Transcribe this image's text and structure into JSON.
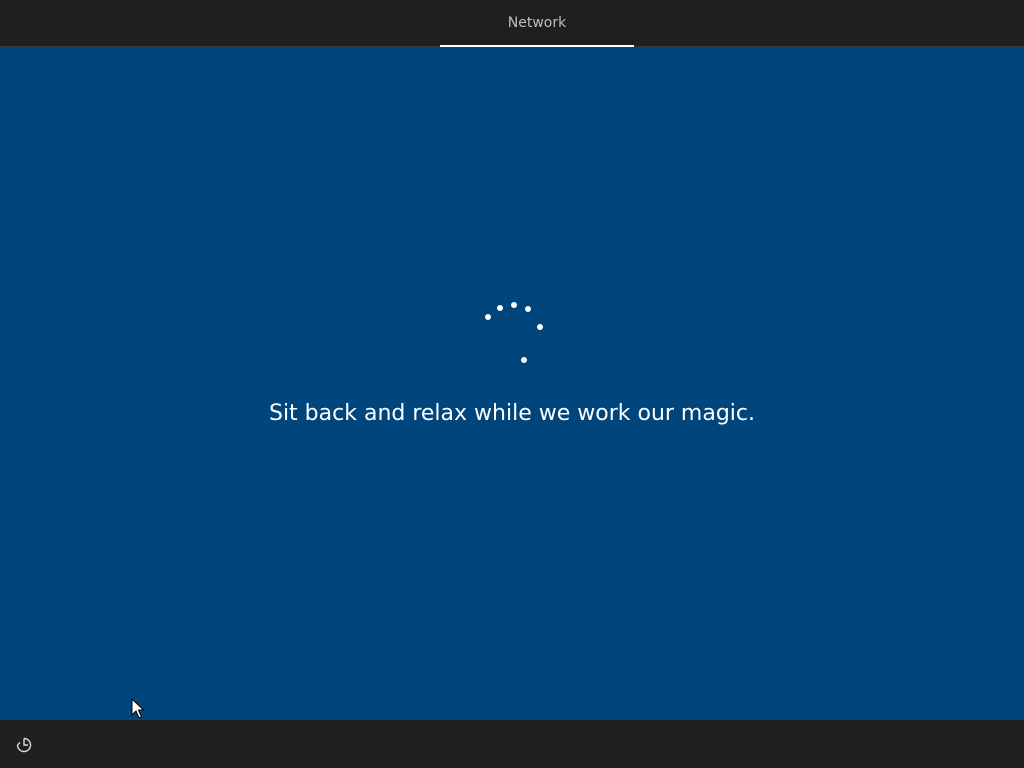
{
  "header": {
    "tabs": [
      {
        "label": "Network",
        "active": true
      }
    ]
  },
  "main": {
    "message": "Sit back and relax while we work our magic.",
    "background_color": "#00457c"
  },
  "footer": {
    "accessibility_icon": "ease-of-access-icon"
  },
  "colors": {
    "topbar": "#1f1f1f",
    "bottombar": "#202020",
    "text": "#ffffff",
    "tab_text": "#bdbdbd"
  }
}
